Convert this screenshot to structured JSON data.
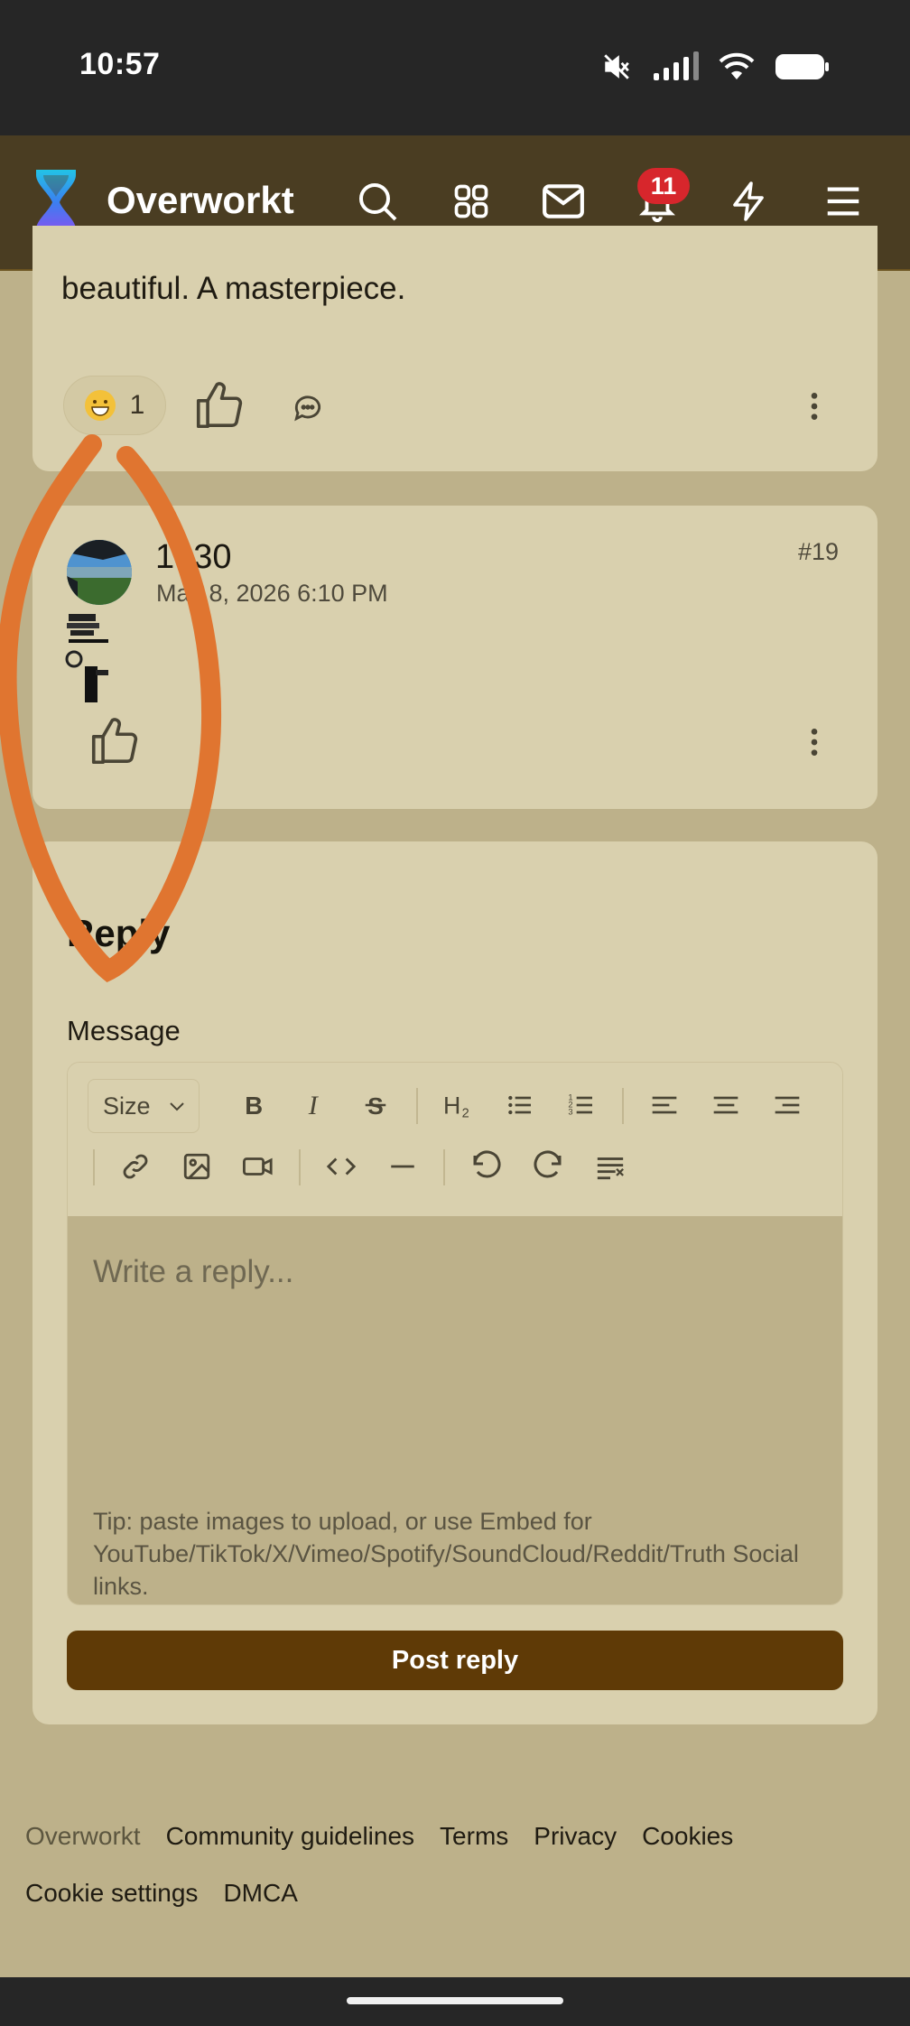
{
  "status_bar": {
    "time": "10:57",
    "icons": [
      "mute-icon",
      "signal-icon",
      "wifi-icon",
      "battery-icon"
    ]
  },
  "header": {
    "brand": "Overworkt",
    "notification_count": "11",
    "icons": [
      "search-icon",
      "apps-grid-icon",
      "mail-icon",
      "bell-icon",
      "lightning-icon",
      "menu-icon"
    ]
  },
  "post_prev": {
    "text_fragment": "beautiful. A masterpiece.",
    "reaction_emoji": "grinning-face",
    "reaction_count": "1"
  },
  "post_19": {
    "author": "1830",
    "date": "May 8, 2026 6:10 PM",
    "number": "#19"
  },
  "reply": {
    "heading": "Reply",
    "message_label": "Message",
    "size_label": "Size",
    "placeholder": "Write a reply...",
    "tip": "Tip: paste images to upload, or use Embed for YouTube/TikTok/X/Vimeo/Spotify/SoundCloud/Reddit/Truth Social links.",
    "submit_label": "Post reply"
  },
  "footer": {
    "brand": "Overworkt",
    "links_row1": [
      "Community guidelines",
      "Terms",
      "Privacy",
      "Cookies"
    ],
    "links_row2": [
      "Cookie settings",
      "DMCA"
    ]
  },
  "colors": {
    "page_bg": "#bdb18a",
    "card_bg": "#d9d0ae",
    "header_bg": "#4a3d22",
    "button_bg": "#5f3a06",
    "badge": "#d7262c",
    "annotation": "#e07530"
  }
}
